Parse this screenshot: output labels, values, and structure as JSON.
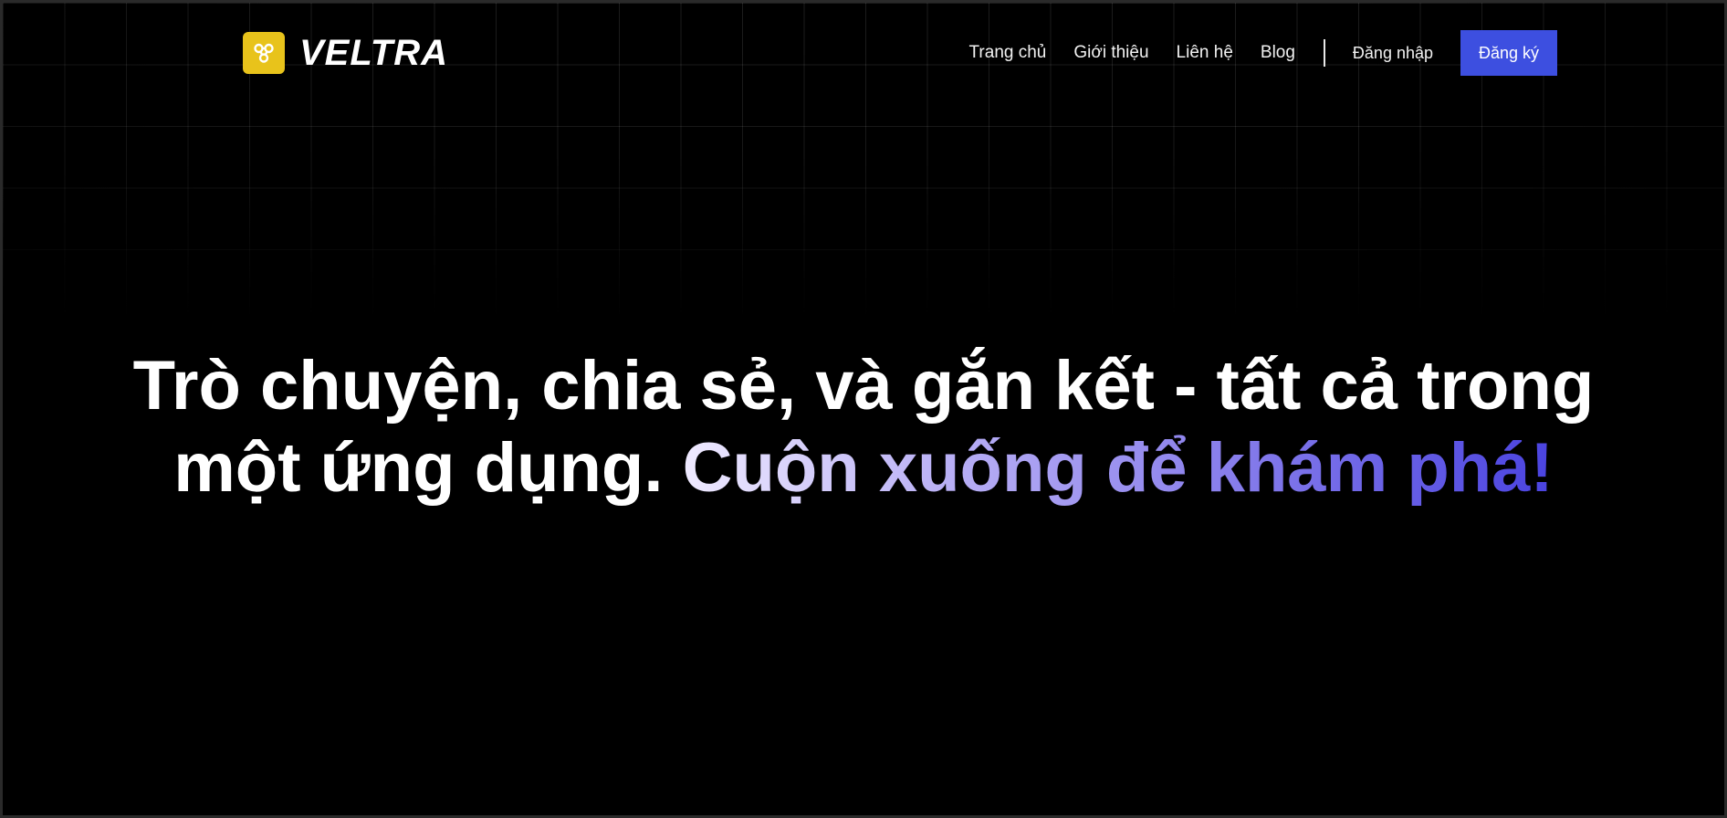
{
  "brand": {
    "name": "VELTRA",
    "logo_icon": "share-nodes-icon",
    "logo_color": "#e8c31b"
  },
  "nav": {
    "items": [
      {
        "label": "Trang chủ"
      },
      {
        "label": "Giới thiệu"
      },
      {
        "label": "Liên hệ"
      },
      {
        "label": "Blog"
      }
    ],
    "login_label": "Đăng nhập",
    "signup_label": "Đăng ký",
    "signup_color": "#3d4fe0"
  },
  "hero": {
    "title_line1": "Trò chuyện, chia sẻ, và gắn kết - tất cả trong",
    "title_line2_plain": "một ứng dụng. ",
    "title_line2_accent": "Cuộn xuống để khám phá!",
    "accent_gradient": [
      "#efeaff",
      "#8c82ec",
      "#4a43e0"
    ]
  },
  "background": "#000000"
}
